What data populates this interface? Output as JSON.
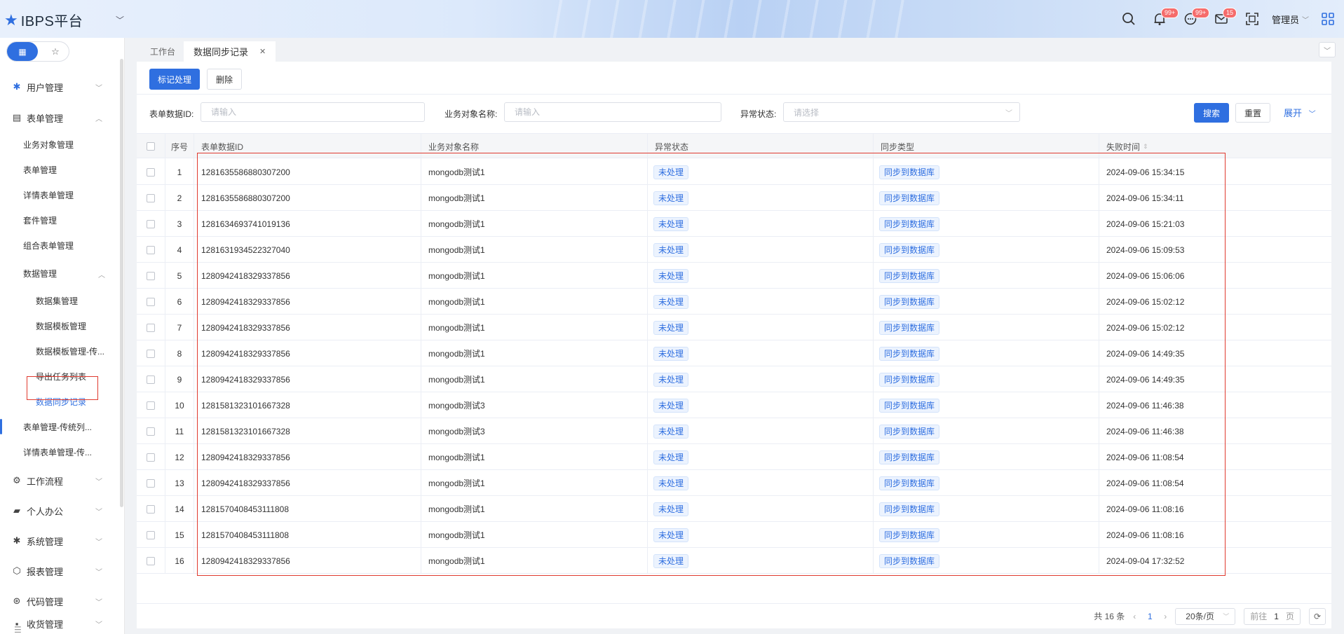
{
  "header": {
    "logo_text": "IBPS平台",
    "badges": {
      "notifications": "99+",
      "messages": "99+",
      "mail": "15"
    },
    "user_name": "管理员"
  },
  "sidebar": {
    "switch_labels": {
      "apps": "▦",
      "favorites": "☆"
    },
    "menus": {
      "user_mgmt": "用户管理",
      "form_mgmt": "表单管理",
      "workflow": "工作流程",
      "personal": "个人办公",
      "system": "系统管理",
      "report": "报表管理",
      "code": "代码管理",
      "more": "收货管理"
    },
    "sub": {
      "biz_object": "业务对象管理",
      "form": "表单管理",
      "detail_form": "详情表单管理",
      "suite": "套件管理",
      "combo_form": "组合表单管理",
      "data_mgmt": "数据管理",
      "dataset": "数据集管理",
      "data_template": "数据模板管理",
      "data_template_trad": "数据模板管理-传...",
      "export_tasks": "导出任务列表",
      "data_sync": "数据同步记录",
      "form_trad": "表单管理-传统列...",
      "detail_form_trad": "详情表单管理-传..."
    }
  },
  "tabs": {
    "workbench": "工作台",
    "current": "数据同步记录"
  },
  "toolbar": {
    "mark": "标记处理",
    "delete": "删除"
  },
  "filters": {
    "form_id_label": "表单数据ID:",
    "form_id_placeholder": "请输入",
    "biz_name_label": "业务对象名称:",
    "biz_name_placeholder": "请输入",
    "status_label": "异常状态:",
    "status_placeholder": "请选择",
    "search": "搜索",
    "reset": "重置",
    "expand": "展开"
  },
  "table": {
    "columns": {
      "index": "序号",
      "form_id": "表单数据ID",
      "biz_name": "业务对象名称",
      "status": "异常状态",
      "sync_type": "同步类型",
      "fail_time": "失败时间"
    },
    "rows": [
      {
        "index": "1",
        "form_id": "1281635586880307200",
        "biz_name": "mongodb测试1",
        "status": "未处理",
        "sync_type": "同步到数据库",
        "fail_time": "2024-09-06 15:34:15"
      },
      {
        "index": "2",
        "form_id": "1281635586880307200",
        "biz_name": "mongodb测试1",
        "status": "未处理",
        "sync_type": "同步到数据库",
        "fail_time": "2024-09-06 15:34:11"
      },
      {
        "index": "3",
        "form_id": "1281634693741019136",
        "biz_name": "mongodb测试1",
        "status": "未处理",
        "sync_type": "同步到数据库",
        "fail_time": "2024-09-06 15:21:03"
      },
      {
        "index": "4",
        "form_id": "1281631934522327040",
        "biz_name": "mongodb测试1",
        "status": "未处理",
        "sync_type": "同步到数据库",
        "fail_time": "2024-09-06 15:09:53"
      },
      {
        "index": "5",
        "form_id": "1280942418329337856",
        "biz_name": "mongodb测试1",
        "status": "未处理",
        "sync_type": "同步到数据库",
        "fail_time": "2024-09-06 15:06:06"
      },
      {
        "index": "6",
        "form_id": "1280942418329337856",
        "biz_name": "mongodb测试1",
        "status": "未处理",
        "sync_type": "同步到数据库",
        "fail_time": "2024-09-06 15:02:12"
      },
      {
        "index": "7",
        "form_id": "1280942418329337856",
        "biz_name": "mongodb测试1",
        "status": "未处理",
        "sync_type": "同步到数据库",
        "fail_time": "2024-09-06 15:02:12"
      },
      {
        "index": "8",
        "form_id": "1280942418329337856",
        "biz_name": "mongodb测试1",
        "status": "未处理",
        "sync_type": "同步到数据库",
        "fail_time": "2024-09-06 14:49:35"
      },
      {
        "index": "9",
        "form_id": "1280942418329337856",
        "biz_name": "mongodb测试1",
        "status": "未处理",
        "sync_type": "同步到数据库",
        "fail_time": "2024-09-06 14:49:35"
      },
      {
        "index": "10",
        "form_id": "1281581323101667328",
        "biz_name": "mongodb测试3",
        "status": "未处理",
        "sync_type": "同步到数据库",
        "fail_time": "2024-09-06 11:46:38"
      },
      {
        "index": "11",
        "form_id": "1281581323101667328",
        "biz_name": "mongodb测试3",
        "status": "未处理",
        "sync_type": "同步到数据库",
        "fail_time": "2024-09-06 11:46:38"
      },
      {
        "index": "12",
        "form_id": "1280942418329337856",
        "biz_name": "mongodb测试1",
        "status": "未处理",
        "sync_type": "同步到数据库",
        "fail_time": "2024-09-06 11:08:54"
      },
      {
        "index": "13",
        "form_id": "1280942418329337856",
        "biz_name": "mongodb测试1",
        "status": "未处理",
        "sync_type": "同步到数据库",
        "fail_time": "2024-09-06 11:08:54"
      },
      {
        "index": "14",
        "form_id": "1281570408453111808",
        "biz_name": "mongodb测试1",
        "status": "未处理",
        "sync_type": "同步到数据库",
        "fail_time": "2024-09-06 11:08:16"
      },
      {
        "index": "15",
        "form_id": "1281570408453111808",
        "biz_name": "mongodb测试1",
        "status": "未处理",
        "sync_type": "同步到数据库",
        "fail_time": "2024-09-06 11:08:16"
      },
      {
        "index": "16",
        "form_id": "1280942418329337856",
        "biz_name": "mongodb测试1",
        "status": "未处理",
        "sync_type": "同步到数据库",
        "fail_time": "2024-09-04 17:32:52"
      }
    ]
  },
  "pager": {
    "total": "共 16 条",
    "current_page": "1",
    "page_size": "20条/页",
    "goto_prefix": "前往",
    "goto_value": "1",
    "goto_suffix": "页"
  },
  "colors": {
    "accent": "#2f6fe0",
    "highlight": "#e03a2f",
    "badge": "#f56c6c"
  }
}
